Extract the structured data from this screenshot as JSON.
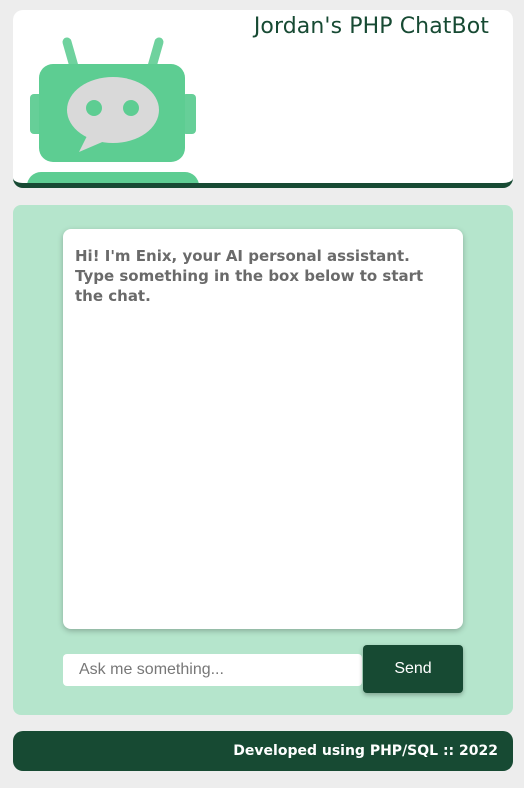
{
  "header": {
    "title": "Jordan's PHP ChatBot",
    "logo_icon": "robot-chat-icon",
    "colors": {
      "dark_green": "#174a33",
      "robot_green": "#5dcd92",
      "bubble_gray": "#d7d7d7"
    }
  },
  "chat": {
    "bot_message": "Hi! I'm Enix, your AI personal assistant. Type something in the box below to start the chat.",
    "input": {
      "value": "",
      "placeholder": "Ask me something..."
    },
    "send_label": "Send",
    "colors": {
      "panel_bg": "#b5e5cc",
      "button_bg": "#174a33"
    }
  },
  "footer": {
    "text": "Developed using PHP/SQL :: 2022"
  }
}
